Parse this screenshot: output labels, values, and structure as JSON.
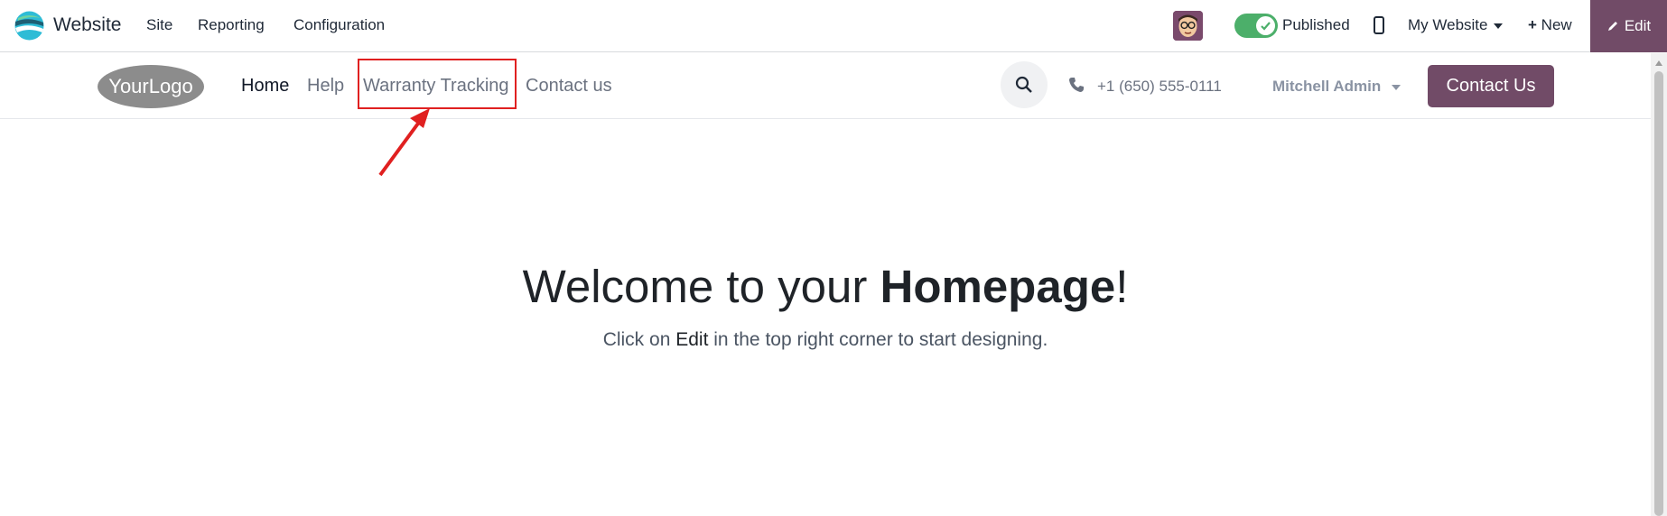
{
  "topbar": {
    "app_name": "Website",
    "menus": [
      "Site",
      "Reporting",
      "Configuration"
    ],
    "published_label": "Published",
    "website_label": "My Website",
    "new_label": "New",
    "edit_label": "Edit",
    "accent": "#714b67",
    "toggle_color": "#4caf6a"
  },
  "site_header": {
    "logo_text": "YourLogo",
    "nav": [
      "Home",
      "Help",
      "Warranty Tracking",
      "Contact us"
    ],
    "phone": "+1 (650) 555-0111",
    "user": "Mitchell Admin",
    "contact_button": "Contact Us"
  },
  "hero": {
    "title_prefix": "Welcome to your ",
    "title_bold": "Homepage",
    "title_suffix": "!",
    "sub_prefix": "Click on ",
    "sub_bold": "Edit",
    "sub_suffix": " in the top right corner to start designing."
  },
  "annotation": {
    "color": "#e02020"
  }
}
